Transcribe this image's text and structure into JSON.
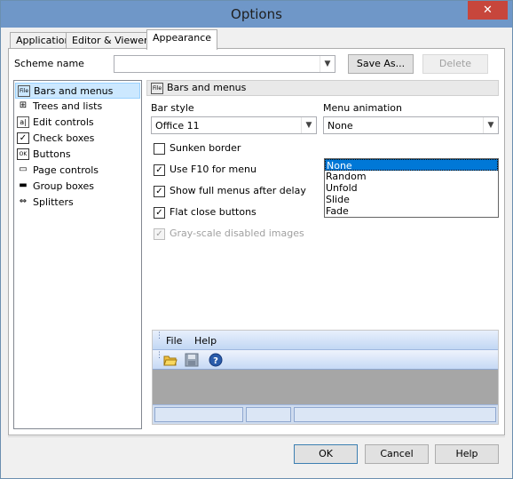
{
  "window": {
    "title": "Options",
    "close_glyph": "✕"
  },
  "tabs": [
    {
      "label": "Application"
    },
    {
      "label": "Editor & Viewers"
    },
    {
      "label": "Appearance"
    }
  ],
  "scheme": {
    "label": "Scheme name",
    "value": "",
    "save_as_label": "Save As...",
    "delete_label": "Delete"
  },
  "sidebar": {
    "items": [
      {
        "label": "Bars and menus",
        "icon": "file-menu-icon",
        "glyph": "File"
      },
      {
        "label": "Trees and lists",
        "icon": "tree-icon",
        "glyph": "⊞"
      },
      {
        "label": "Edit controls",
        "icon": "edit-control-icon",
        "glyph": "a|"
      },
      {
        "label": "Check boxes",
        "icon": "checkbox-icon",
        "glyph": "✓"
      },
      {
        "label": "Buttons",
        "icon": "button-icon",
        "glyph": "OK"
      },
      {
        "label": "Page controls",
        "icon": "page-control-icon",
        "glyph": "▭"
      },
      {
        "label": "Group boxes",
        "icon": "group-box-icon",
        "glyph": "▬"
      },
      {
        "label": "Splitters",
        "icon": "splitter-icon",
        "glyph": "⇔"
      }
    ]
  },
  "panel": {
    "header": "Bars and menus",
    "bar_style_label": "Bar style",
    "bar_style_value": "Office 11",
    "menu_animation_label": "Menu animation",
    "menu_animation_value": "None",
    "menu_animation_options": [
      "None",
      "Random",
      "Unfold",
      "Slide",
      "Fade"
    ],
    "checkboxes": [
      {
        "label": "Sunken border",
        "checked": false,
        "disabled": false
      },
      {
        "label": "Use F10 for menu",
        "checked": true,
        "disabled": false
      },
      {
        "label": "Show full menus after delay",
        "checked": true,
        "disabled": false
      },
      {
        "label": "Flat close buttons",
        "checked": true,
        "disabled": false
      },
      {
        "label": "Gray-scale disabled images",
        "checked": true,
        "disabled": true
      }
    ]
  },
  "preview": {
    "menu_items": [
      "File",
      "Help"
    ],
    "toolbar_icons": [
      "open-folder-icon",
      "save-icon",
      "help-icon"
    ]
  },
  "footer": {
    "ok_label": "OK",
    "cancel_label": "Cancel",
    "help_label": "Help"
  },
  "colors": {
    "titlebar": "#6f97c8",
    "close_button": "#c7463c",
    "selection": "#0078d7"
  }
}
